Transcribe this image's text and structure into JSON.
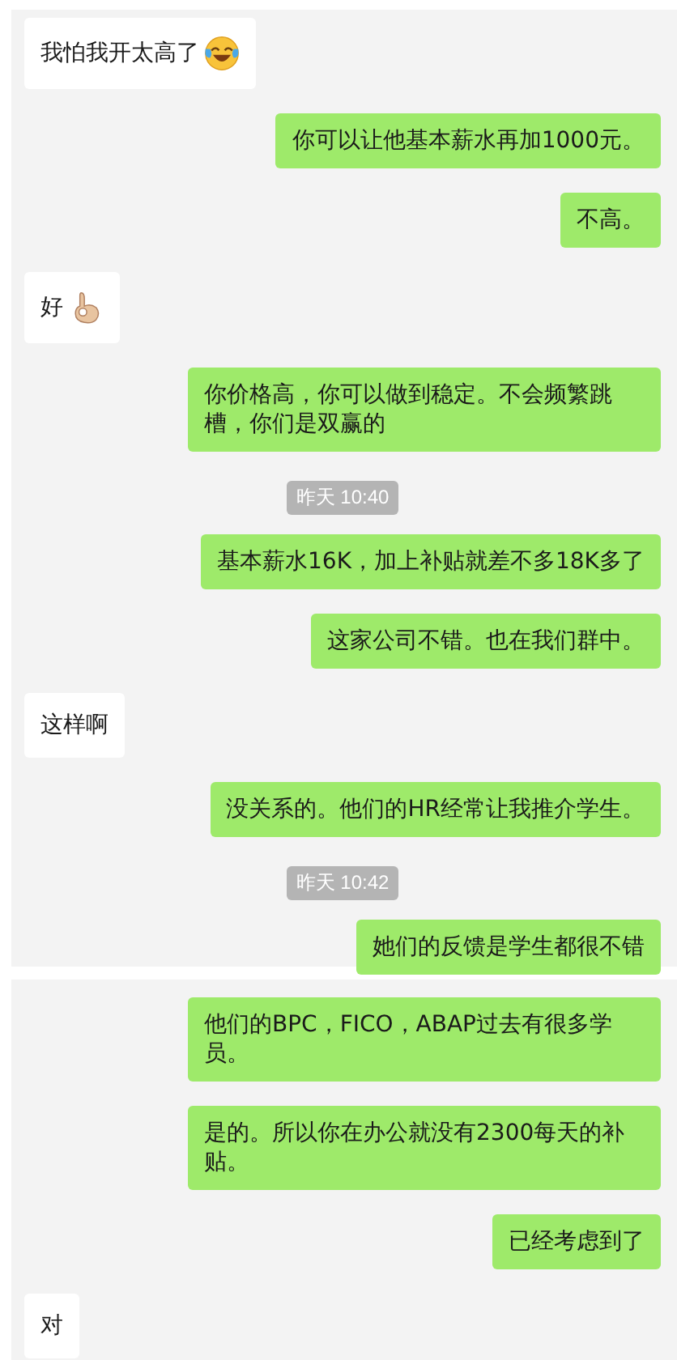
{
  "panels": [
    {
      "messages": [
        {
          "kind": "incoming",
          "text": "我怕我开太高了",
          "emoji": {
            "kind": "laughing"
          }
        },
        {
          "kind": "outgoing",
          "text": "你可以让他基本薪水再加1000元。"
        },
        {
          "kind": "outgoing",
          "text": "不高。"
        },
        {
          "kind": "incoming",
          "text": "好",
          "emoji": {
            "kind": "ok_hand"
          }
        },
        {
          "kind": "outgoing",
          "text": "你价格高，你可以做到稳定。不会频繁跳槽，你们是双赢的"
        },
        {
          "kind": "timestamp",
          "text": "昨天 10:40"
        },
        {
          "kind": "outgoing",
          "text": "基本薪水16K，加上补贴就差不多18K多了"
        },
        {
          "kind": "outgoing",
          "text": "这家公司不错。也在我们群中。"
        },
        {
          "kind": "incoming",
          "text": "这样啊"
        },
        {
          "kind": "outgoing",
          "text": "没关系的。他们的HR经常让我推介学生。"
        },
        {
          "kind": "timestamp",
          "text": "昨天 10:42"
        },
        {
          "kind": "outgoing",
          "text": "她们的反馈是学生都很不错"
        }
      ]
    },
    {
      "messages": [
        {
          "kind": "outgoing",
          "text": "他们的BPC，FICO，ABAP过去有很多学员。"
        },
        {
          "kind": "outgoing",
          "text": "是的。所以你在办公就没有2300每天的补贴。"
        },
        {
          "kind": "outgoing",
          "text": "已经考虑到了"
        },
        {
          "kind": "incoming",
          "text": "对"
        }
      ]
    }
  ]
}
